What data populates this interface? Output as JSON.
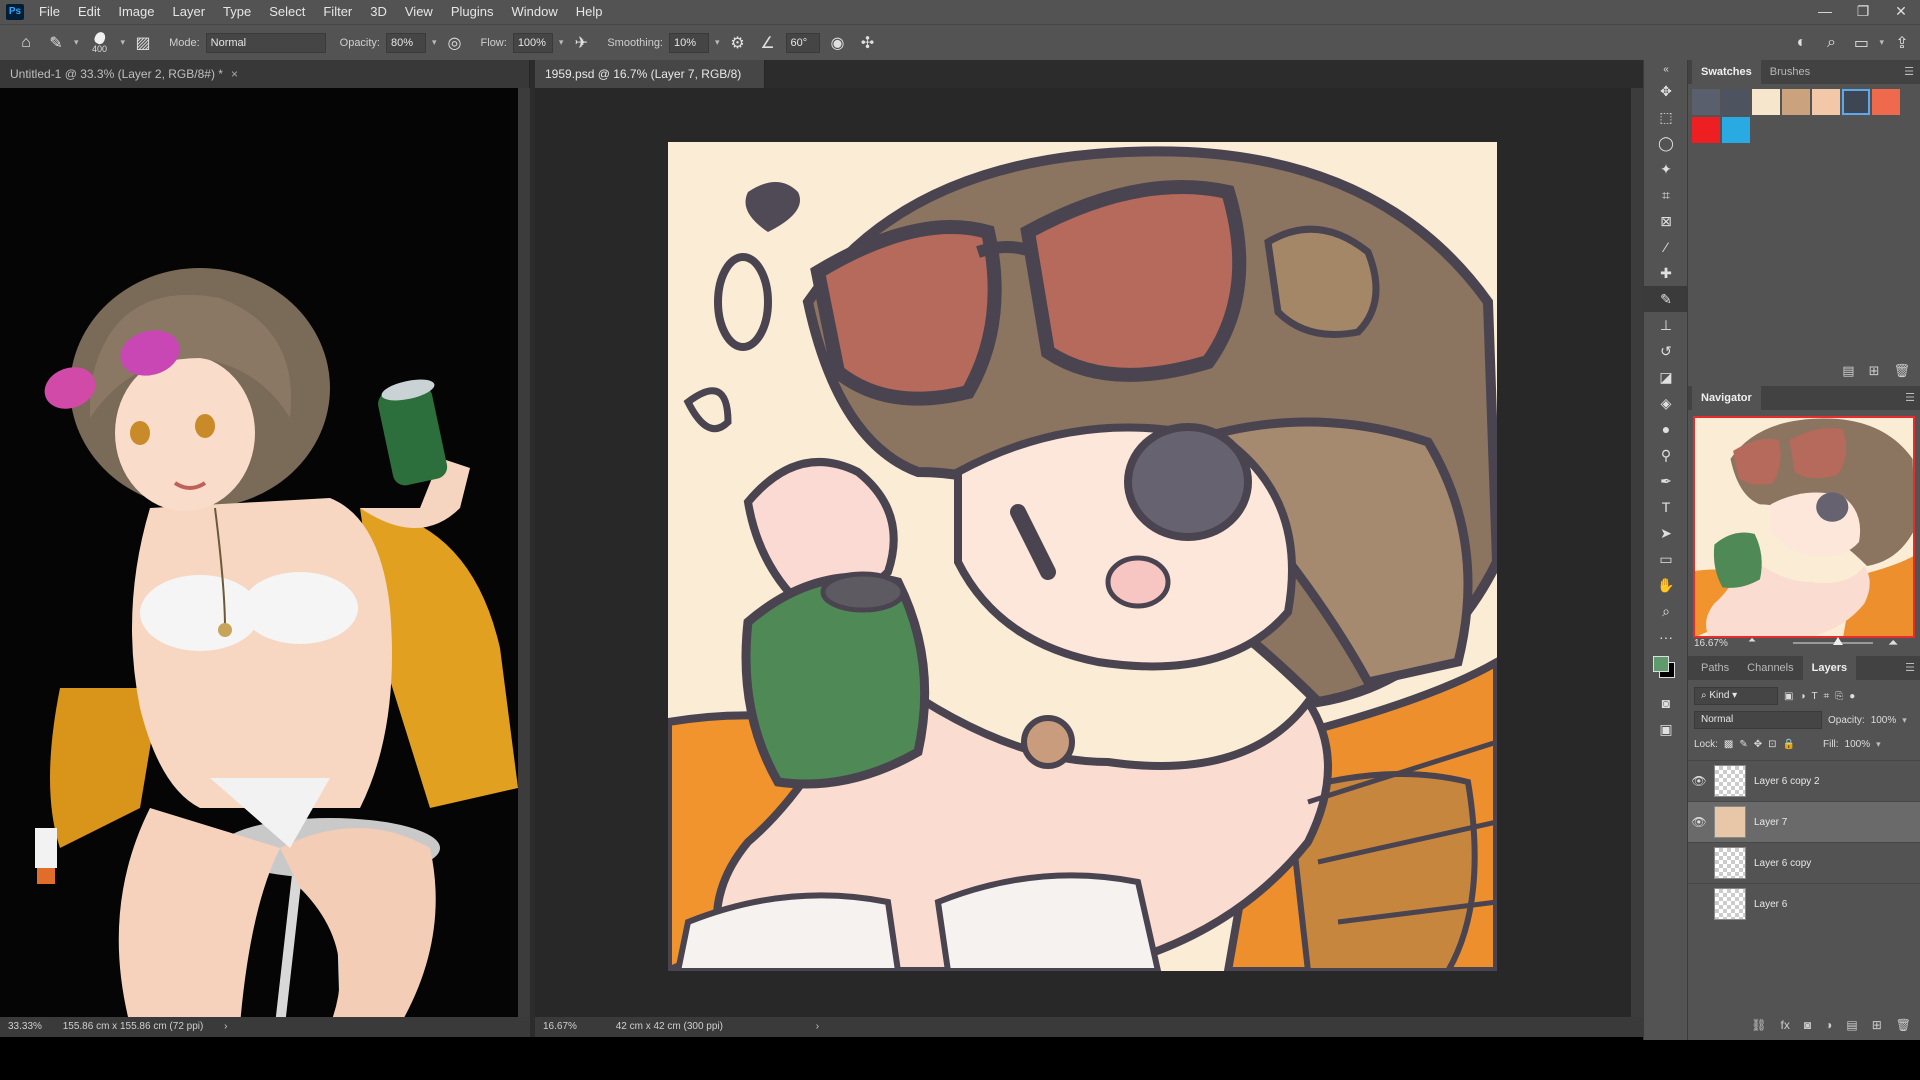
{
  "app": {
    "logo": "Ps"
  },
  "menu": [
    "File",
    "Edit",
    "Image",
    "Layer",
    "Type",
    "Select",
    "Filter",
    "3D",
    "View",
    "Plugins",
    "Window",
    "Help"
  ],
  "window_controls": [
    "—",
    "❐",
    "✕"
  ],
  "options": {
    "brush_size": "400",
    "mode_label": "Mode:",
    "mode_value": "Normal",
    "opacity_label": "Opacity:",
    "opacity_value": "80%",
    "flow_label": "Flow:",
    "flow_value": "100%",
    "smoothing_label": "Smoothing:",
    "smoothing_value": "10%",
    "angle_value": "60°"
  },
  "documents": [
    {
      "tab": "Untitled-1 @ 33.3% (Layer 2, RGB/8#) *",
      "zoom": "33.33%",
      "size": "155.86 cm x 155.86 cm (72 ppi)"
    },
    {
      "tab": "1959.psd @ 16.7% (Layer 7, RGB/8) *",
      "zoom": "16.67%",
      "size": "42 cm x 42 cm (300 ppi)"
    }
  ],
  "panels": {
    "swatch_tabs": [
      "Swatches",
      "Brushes"
    ],
    "swatches": [
      "#5a5f6e",
      "#4e5360",
      "#f6e6cc",
      "#caa27e",
      "#f3c8a8",
      "#3f4653",
      "#ef6a4c",
      "#ee1f23",
      "#29aae2"
    ],
    "navigator_title": "Navigator",
    "navigator_zoom": "16.67%",
    "layer_tabs": [
      "Paths",
      "Channels",
      "Layers"
    ],
    "kind_label": "Kind",
    "blend_mode": "Normal",
    "opacity_label": "Opacity:",
    "opacity_value": "100%",
    "lock_label": "Lock:",
    "fill_label": "Fill:",
    "fill_value": "100%",
    "layers": [
      {
        "name": "Layer 6 copy 2",
        "visible": true,
        "active": false
      },
      {
        "name": "Layer 7",
        "visible": true,
        "active": true
      },
      {
        "name": "Layer 6 copy",
        "visible": false,
        "active": false
      },
      {
        "name": "Layer 6",
        "visible": false,
        "active": false
      }
    ]
  },
  "colors": {
    "foreground": "#5f9a6c",
    "background": "#000000",
    "accent": "#31a8ff"
  }
}
